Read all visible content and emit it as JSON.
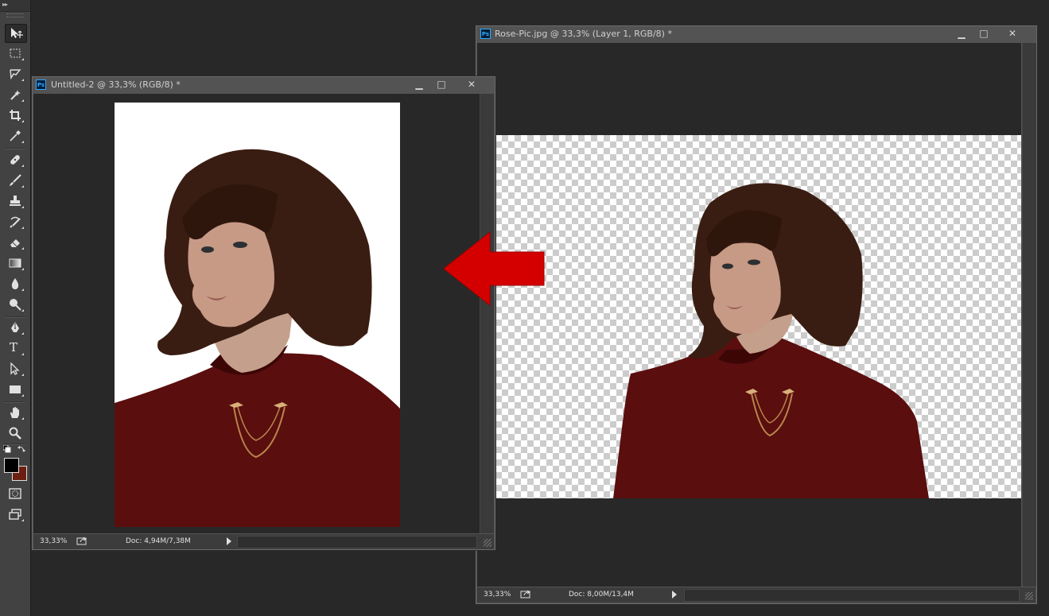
{
  "toolbar": {
    "collapse_glyph": "▸▸",
    "tools": [
      {
        "name": "move-tool-icon",
        "active": true
      },
      {
        "name": "marquee-tool-icon"
      },
      {
        "name": "lasso-tool-icon"
      },
      {
        "name": "magic-wand-tool-icon"
      },
      {
        "name": "crop-tool-icon"
      },
      {
        "name": "eyedropper-tool-icon"
      },
      {
        "name": "healing-brush-tool-icon"
      },
      {
        "name": "brush-tool-icon"
      },
      {
        "name": "clone-stamp-tool-icon"
      },
      {
        "name": "history-brush-tool-icon"
      },
      {
        "name": "eraser-tool-icon"
      },
      {
        "name": "gradient-tool-icon"
      },
      {
        "name": "blur-tool-icon"
      },
      {
        "name": "dodge-tool-icon"
      },
      {
        "name": "pen-tool-icon"
      },
      {
        "name": "type-tool-icon",
        "glyph": "T"
      },
      {
        "name": "path-selection-tool-icon"
      },
      {
        "name": "rectangle-tool-icon"
      },
      {
        "name": "hand-tool-icon"
      },
      {
        "name": "zoom-tool-icon"
      }
    ],
    "foreground_color": "#000000",
    "background_color": "#6b1f10"
  },
  "windows": {
    "left": {
      "app_badge": "Ps",
      "title": "Untitled-2 @ 33,3% (RGB/8) *",
      "zoom": "33,33%",
      "doc_info": "Doc: 4,94M/7,38M",
      "minimize": "▁",
      "maximize": "□",
      "close": "✕"
    },
    "right": {
      "app_badge": "Ps",
      "title": "Rose-Pic.jpg @ 33,3% (Layer 1, RGB/8) *",
      "zoom": "33,33%",
      "doc_info": "Doc: 8,00M/13,4M",
      "minimize": "▁",
      "maximize": "□",
      "close": "✕"
    }
  },
  "colors": {
    "arrow": "#d40000",
    "shirt": "#5a0e0e",
    "hair": "#3a1d12",
    "skin": "#c79a86"
  }
}
